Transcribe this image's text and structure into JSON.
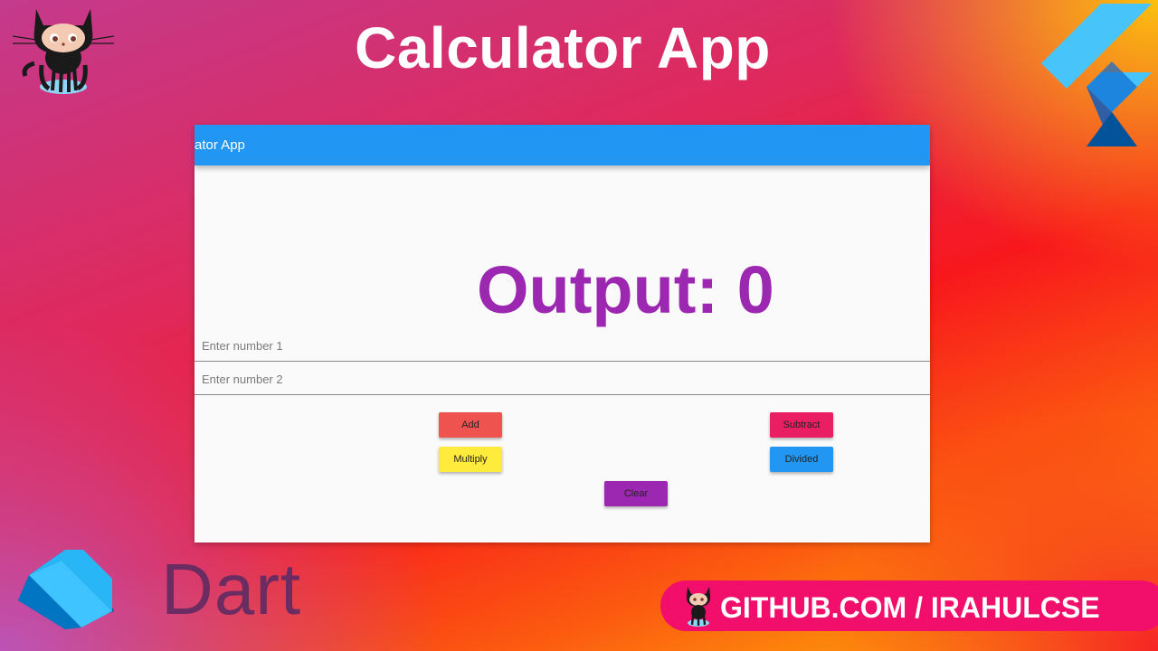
{
  "header": {
    "title": "Calculator App"
  },
  "app": {
    "appbar_title": "ator App",
    "output_text": "Output: 0",
    "fields": [
      {
        "placeholder": "Enter number 1",
        "value": ""
      },
      {
        "placeholder": "Enter number 2",
        "value": ""
      }
    ],
    "buttons": {
      "add": "Add",
      "subtract": "Subtract",
      "multiply": "Multiply",
      "divided": "Divided",
      "clear": "Clear"
    },
    "colors": {
      "appbar": "#2196f3",
      "output": "#9c27b0",
      "add": "#ef5350",
      "subtract": "#e91e63",
      "multiply": "#ffeb3b",
      "divided": "#2196f3",
      "clear": "#9c27b0"
    }
  },
  "branding": {
    "dart_word": "Dart",
    "github_link": "GITHUB.COM / IRAHULCSE",
    "icons": [
      "octocat-icon",
      "flutter-logo-icon",
      "dart-logo-icon"
    ]
  }
}
